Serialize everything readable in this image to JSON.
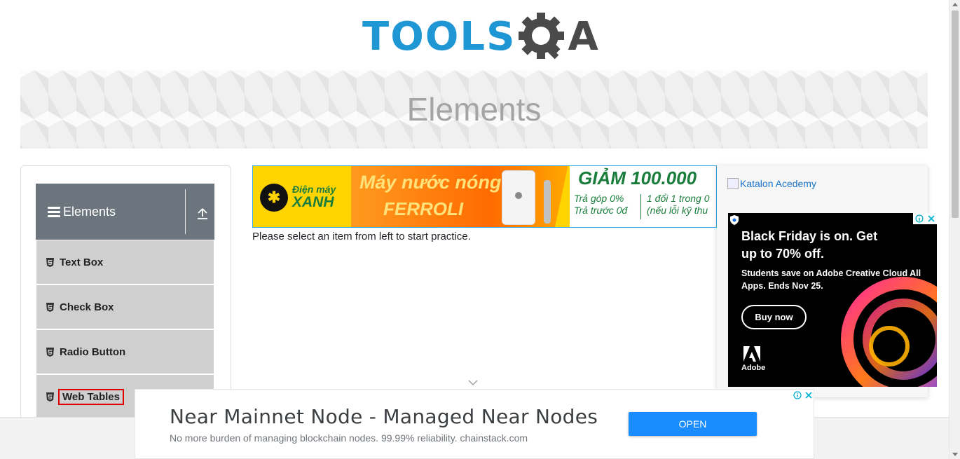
{
  "header": {
    "logo_text": "TOOLS",
    "logo_suffix": "A",
    "logo_icon": "gear-magnifier-icon"
  },
  "banner": {
    "title": "Elements"
  },
  "sidebar": {
    "group_title": "Elements",
    "group_icon": "hamburger-icon",
    "collapse_icon": "upload-arrow-icon",
    "items": [
      {
        "label": "Text Box",
        "icon": "html5-icon"
      },
      {
        "label": "Check Box",
        "icon": "html5-icon"
      },
      {
        "label": "Radio Button",
        "icon": "html5-icon"
      },
      {
        "label": "Web Tables",
        "icon": "html5-icon"
      }
    ]
  },
  "top_ad": {
    "brand_line1": "Điện máy",
    "brand_line2": "XANH",
    "product_line1": "Máy nước nóng",
    "product_line2": "FERROLI",
    "deal_big": "GIẢM 100.000",
    "deal_col1": [
      "Trả góp 0%",
      "Trả trước 0đ"
    ],
    "deal_col2": [
      "1 đổi 1 trong 0",
      "(nếu lỗi kỹ thu"
    ]
  },
  "main": {
    "practice_text": "Please select an item from left to start practice."
  },
  "right_ad": {
    "katalon_alt": "Katalon Acedemy",
    "headline": "Black Friday is on. Get up to 70% off.",
    "body": "Students save on Adobe Creative Cloud All Apps. Ends Nov 25.",
    "cta": "Buy now",
    "brand": "Adobe"
  },
  "bottom_ad": {
    "headline": "Near Mainnet Node - Managed Near Nodes",
    "subline": "No more burden of managing blockchain nodes. 99.99% reliability. chainstack.com",
    "cta": "OPEN"
  },
  "colors": {
    "brand_blue": "#1f97d4",
    "logo_gray": "#4a4a4a",
    "sidebar_header": "#6c757d",
    "menu_item": "#cfcfcf",
    "highlight_box": "#e00000",
    "open_button": "#1a8cff"
  }
}
